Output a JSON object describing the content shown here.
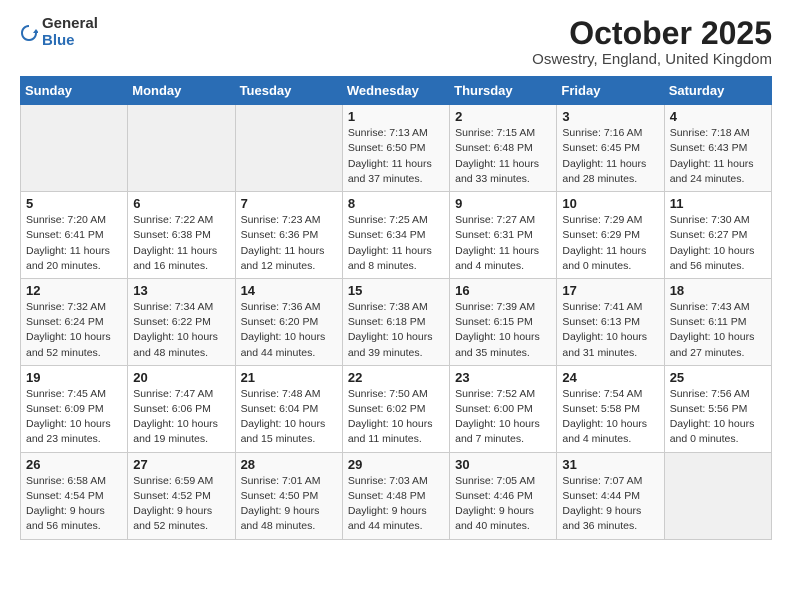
{
  "logo": {
    "general": "General",
    "blue": "Blue"
  },
  "title": "October 2025",
  "subtitle": "Oswestry, England, United Kingdom",
  "headers": [
    "Sunday",
    "Monday",
    "Tuesday",
    "Wednesday",
    "Thursday",
    "Friday",
    "Saturday"
  ],
  "weeks": [
    [
      {
        "day": "",
        "info": ""
      },
      {
        "day": "",
        "info": ""
      },
      {
        "day": "",
        "info": ""
      },
      {
        "day": "1",
        "info": "Sunrise: 7:13 AM\nSunset: 6:50 PM\nDaylight: 11 hours\nand 37 minutes."
      },
      {
        "day": "2",
        "info": "Sunrise: 7:15 AM\nSunset: 6:48 PM\nDaylight: 11 hours\nand 33 minutes."
      },
      {
        "day": "3",
        "info": "Sunrise: 7:16 AM\nSunset: 6:45 PM\nDaylight: 11 hours\nand 28 minutes."
      },
      {
        "day": "4",
        "info": "Sunrise: 7:18 AM\nSunset: 6:43 PM\nDaylight: 11 hours\nand 24 minutes."
      }
    ],
    [
      {
        "day": "5",
        "info": "Sunrise: 7:20 AM\nSunset: 6:41 PM\nDaylight: 11 hours\nand 20 minutes."
      },
      {
        "day": "6",
        "info": "Sunrise: 7:22 AM\nSunset: 6:38 PM\nDaylight: 11 hours\nand 16 minutes."
      },
      {
        "day": "7",
        "info": "Sunrise: 7:23 AM\nSunset: 6:36 PM\nDaylight: 11 hours\nand 12 minutes."
      },
      {
        "day": "8",
        "info": "Sunrise: 7:25 AM\nSunset: 6:34 PM\nDaylight: 11 hours\nand 8 minutes."
      },
      {
        "day": "9",
        "info": "Sunrise: 7:27 AM\nSunset: 6:31 PM\nDaylight: 11 hours\nand 4 minutes."
      },
      {
        "day": "10",
        "info": "Sunrise: 7:29 AM\nSunset: 6:29 PM\nDaylight: 11 hours\nand 0 minutes."
      },
      {
        "day": "11",
        "info": "Sunrise: 7:30 AM\nSunset: 6:27 PM\nDaylight: 10 hours\nand 56 minutes."
      }
    ],
    [
      {
        "day": "12",
        "info": "Sunrise: 7:32 AM\nSunset: 6:24 PM\nDaylight: 10 hours\nand 52 minutes."
      },
      {
        "day": "13",
        "info": "Sunrise: 7:34 AM\nSunset: 6:22 PM\nDaylight: 10 hours\nand 48 minutes."
      },
      {
        "day": "14",
        "info": "Sunrise: 7:36 AM\nSunset: 6:20 PM\nDaylight: 10 hours\nand 44 minutes."
      },
      {
        "day": "15",
        "info": "Sunrise: 7:38 AM\nSunset: 6:18 PM\nDaylight: 10 hours\nand 39 minutes."
      },
      {
        "day": "16",
        "info": "Sunrise: 7:39 AM\nSunset: 6:15 PM\nDaylight: 10 hours\nand 35 minutes."
      },
      {
        "day": "17",
        "info": "Sunrise: 7:41 AM\nSunset: 6:13 PM\nDaylight: 10 hours\nand 31 minutes."
      },
      {
        "day": "18",
        "info": "Sunrise: 7:43 AM\nSunset: 6:11 PM\nDaylight: 10 hours\nand 27 minutes."
      }
    ],
    [
      {
        "day": "19",
        "info": "Sunrise: 7:45 AM\nSunset: 6:09 PM\nDaylight: 10 hours\nand 23 minutes."
      },
      {
        "day": "20",
        "info": "Sunrise: 7:47 AM\nSunset: 6:06 PM\nDaylight: 10 hours\nand 19 minutes."
      },
      {
        "day": "21",
        "info": "Sunrise: 7:48 AM\nSunset: 6:04 PM\nDaylight: 10 hours\nand 15 minutes."
      },
      {
        "day": "22",
        "info": "Sunrise: 7:50 AM\nSunset: 6:02 PM\nDaylight: 10 hours\nand 11 minutes."
      },
      {
        "day": "23",
        "info": "Sunrise: 7:52 AM\nSunset: 6:00 PM\nDaylight: 10 hours\nand 7 minutes."
      },
      {
        "day": "24",
        "info": "Sunrise: 7:54 AM\nSunset: 5:58 PM\nDaylight: 10 hours\nand 4 minutes."
      },
      {
        "day": "25",
        "info": "Sunrise: 7:56 AM\nSunset: 5:56 PM\nDaylight: 10 hours\nand 0 minutes."
      }
    ],
    [
      {
        "day": "26",
        "info": "Sunrise: 6:58 AM\nSunset: 4:54 PM\nDaylight: 9 hours\nand 56 minutes."
      },
      {
        "day": "27",
        "info": "Sunrise: 6:59 AM\nSunset: 4:52 PM\nDaylight: 9 hours\nand 52 minutes."
      },
      {
        "day": "28",
        "info": "Sunrise: 7:01 AM\nSunset: 4:50 PM\nDaylight: 9 hours\nand 48 minutes."
      },
      {
        "day": "29",
        "info": "Sunrise: 7:03 AM\nSunset: 4:48 PM\nDaylight: 9 hours\nand 44 minutes."
      },
      {
        "day": "30",
        "info": "Sunrise: 7:05 AM\nSunset: 4:46 PM\nDaylight: 9 hours\nand 40 minutes."
      },
      {
        "day": "31",
        "info": "Sunrise: 7:07 AM\nSunset: 4:44 PM\nDaylight: 9 hours\nand 36 minutes."
      },
      {
        "day": "",
        "info": ""
      }
    ]
  ]
}
